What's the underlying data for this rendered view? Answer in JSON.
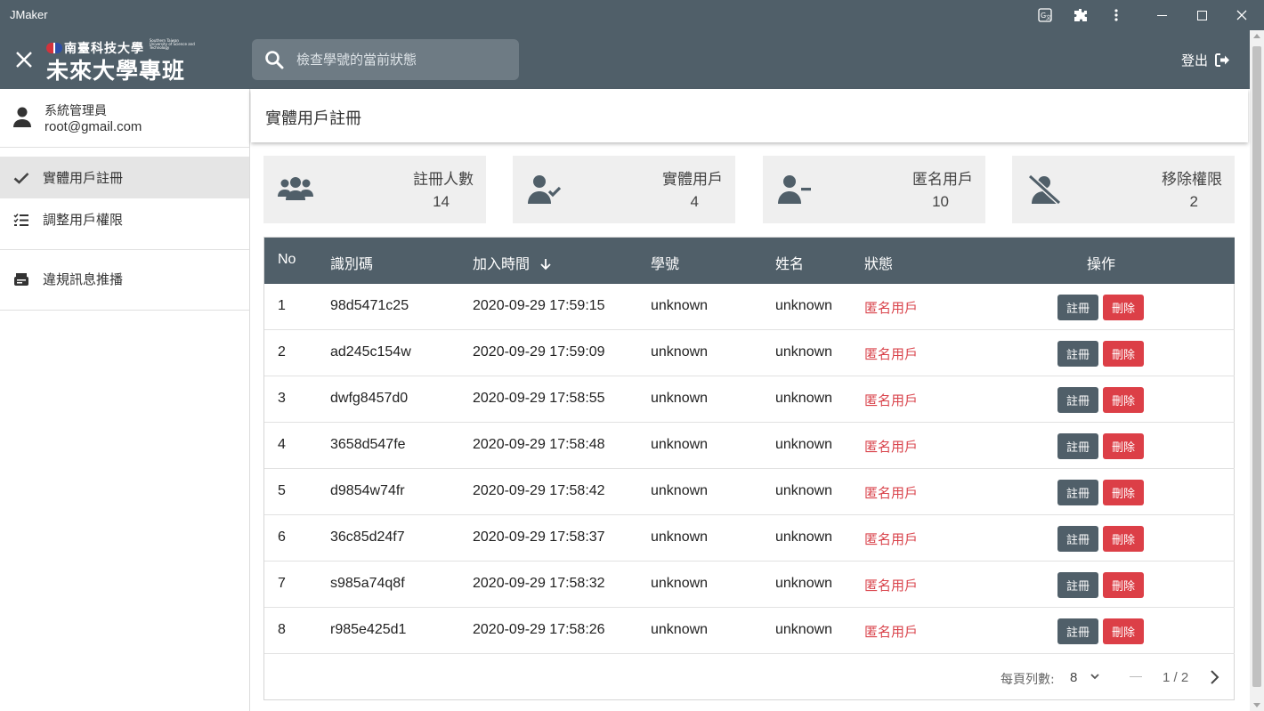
{
  "window": {
    "title": "JMaker"
  },
  "header": {
    "logo_school": "南臺科技大學",
    "logo_school_en": "Southern Taiwan University of Science and Technology",
    "logo_program": "未來大學專班",
    "search_placeholder": "檢查學號的當前狀態",
    "logout_label": "登出"
  },
  "sidebar": {
    "user": {
      "role": "系統管理員",
      "email": "root@gmail.com"
    },
    "items": [
      {
        "label": "實體用戶註冊",
        "icon": "check-icon",
        "active": true
      },
      {
        "label": "調整用戶權限",
        "icon": "checklist-icon",
        "active": false
      },
      {
        "label": "違規訊息推播",
        "icon": "message-icon",
        "active": false
      }
    ]
  },
  "page": {
    "title": "實體用戶註冊"
  },
  "stats": [
    {
      "label": "註冊人數",
      "value": "14",
      "icon": "users-group-icon"
    },
    {
      "label": "實體用戶",
      "value": "4",
      "icon": "user-check-icon"
    },
    {
      "label": "匿名用戶",
      "value": "10",
      "icon": "user-minus-icon"
    },
    {
      "label": "移除權限",
      "value": "2",
      "icon": "user-slash-icon"
    }
  ],
  "table": {
    "headers": {
      "no": "No",
      "id": "識別碼",
      "joined": "加入時間",
      "student_id": "學號",
      "name": "姓名",
      "status": "狀態",
      "actions": "操作"
    },
    "sort_column": "joined",
    "sort_direction": "descending",
    "register_label": "註冊",
    "delete_label": "刪除",
    "rows": [
      {
        "no": "1",
        "id": "98d5471c25",
        "joined": "2020-09-29 17:59:15",
        "student_id": "unknown",
        "name": "unknown",
        "status": "匿名用戶"
      },
      {
        "no": "2",
        "id": "ad245c154w",
        "joined": "2020-09-29 17:59:09",
        "student_id": "unknown",
        "name": "unknown",
        "status": "匿名用戶"
      },
      {
        "no": "3",
        "id": "dwfg8457d0",
        "joined": "2020-09-29 17:58:55",
        "student_id": "unknown",
        "name": "unknown",
        "status": "匿名用戶"
      },
      {
        "no": "4",
        "id": "3658d547fe",
        "joined": "2020-09-29 17:58:48",
        "student_id": "unknown",
        "name": "unknown",
        "status": "匿名用戶"
      },
      {
        "no": "5",
        "id": "d9854w74fr",
        "joined": "2020-09-29 17:58:42",
        "student_id": "unknown",
        "name": "unknown",
        "status": "匿名用戶"
      },
      {
        "no": "6",
        "id": "36c85d24f7",
        "joined": "2020-09-29 17:58:37",
        "student_id": "unknown",
        "name": "unknown",
        "status": "匿名用戶"
      },
      {
        "no": "7",
        "id": "s985a74q8f",
        "joined": "2020-09-29 17:58:32",
        "student_id": "unknown",
        "name": "unknown",
        "status": "匿名用戶"
      },
      {
        "no": "8",
        "id": "r985e425d1",
        "joined": "2020-09-29 17:58:26",
        "student_id": "unknown",
        "name": "unknown",
        "status": "匿名用戶"
      }
    ]
  },
  "pagination": {
    "rows_per_page_label": "每頁列數:",
    "rows_per_page": "8",
    "page_info": "1 / 2"
  },
  "colors": {
    "primary": "#505f69",
    "danger": "#dc3f47",
    "status_text": "#d9434b",
    "card_bg": "#efefef"
  }
}
